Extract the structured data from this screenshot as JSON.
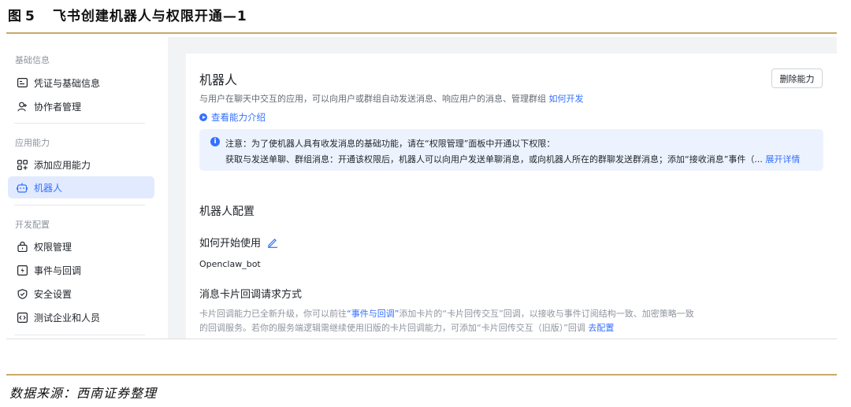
{
  "figure": {
    "label": "图",
    "number": "5",
    "title": "飞书创建机器人与权限开通—1",
    "source": "数据来源：西南证券整理"
  },
  "sidebar": {
    "groups": [
      {
        "label": "基础信息"
      },
      {
        "label": "应用能力"
      },
      {
        "label": "开发配置"
      }
    ],
    "items": [
      {
        "label": "凭证与基础信息",
        "icon": "id-card-icon"
      },
      {
        "label": "协作者管理",
        "icon": "user-add-icon"
      },
      {
        "label": "添加应用能力",
        "icon": "grid-plus-icon"
      },
      {
        "label": "机器人",
        "icon": "robot-icon",
        "active": true
      },
      {
        "label": "权限管理",
        "icon": "lock-icon"
      },
      {
        "label": "事件与回调",
        "icon": "event-icon"
      },
      {
        "label": "安全设置",
        "icon": "shield-icon"
      },
      {
        "label": "测试企业和人员",
        "icon": "code-icon"
      }
    ]
  },
  "main": {
    "title": "机器人",
    "delete_button": "删除能力",
    "description": "与用户在聊天中交互的应用，可以向用户或群组自动发送消息、响应用户的消息、管理群组",
    "how_to_develop": "如何开发",
    "view_intro": "查看能力介绍",
    "notice": {
      "line1": "注意：为了使机器人具有收发消息的基础功能，请在“权限管理”面板中开通以下权限：",
      "line2": "获取与发送单聊、群组消息：开通该权限后，机器人可以向用户发送单聊消息，或向机器人所在的群聊发送群消息；添加“接收消息”事件（...",
      "expand": "展开详情"
    },
    "config_title": "机器人配置",
    "how_to_start": "如何开始使用",
    "bot_name": "Openclaw_bot",
    "card_title": "消息卡片回调请求方式",
    "card_desc1_a": "卡片回调能力已全新升级，你可以前往",
    "card_desc1_link": "“事件与回调”",
    "card_desc1_b": "添加卡片的“卡片回传交互”回调，以接收与事件订阅结构一致、加密策略一致",
    "card_desc2": "的回调服务。若你的服务端逻辑需继续使用旧版的卡片回调能力，可添加“卡片回传交互（旧版）”回调",
    "card_desc2_link": "去配置"
  },
  "colors": {
    "accent": "#3370ff",
    "gold_rule": "#c9a86a"
  }
}
